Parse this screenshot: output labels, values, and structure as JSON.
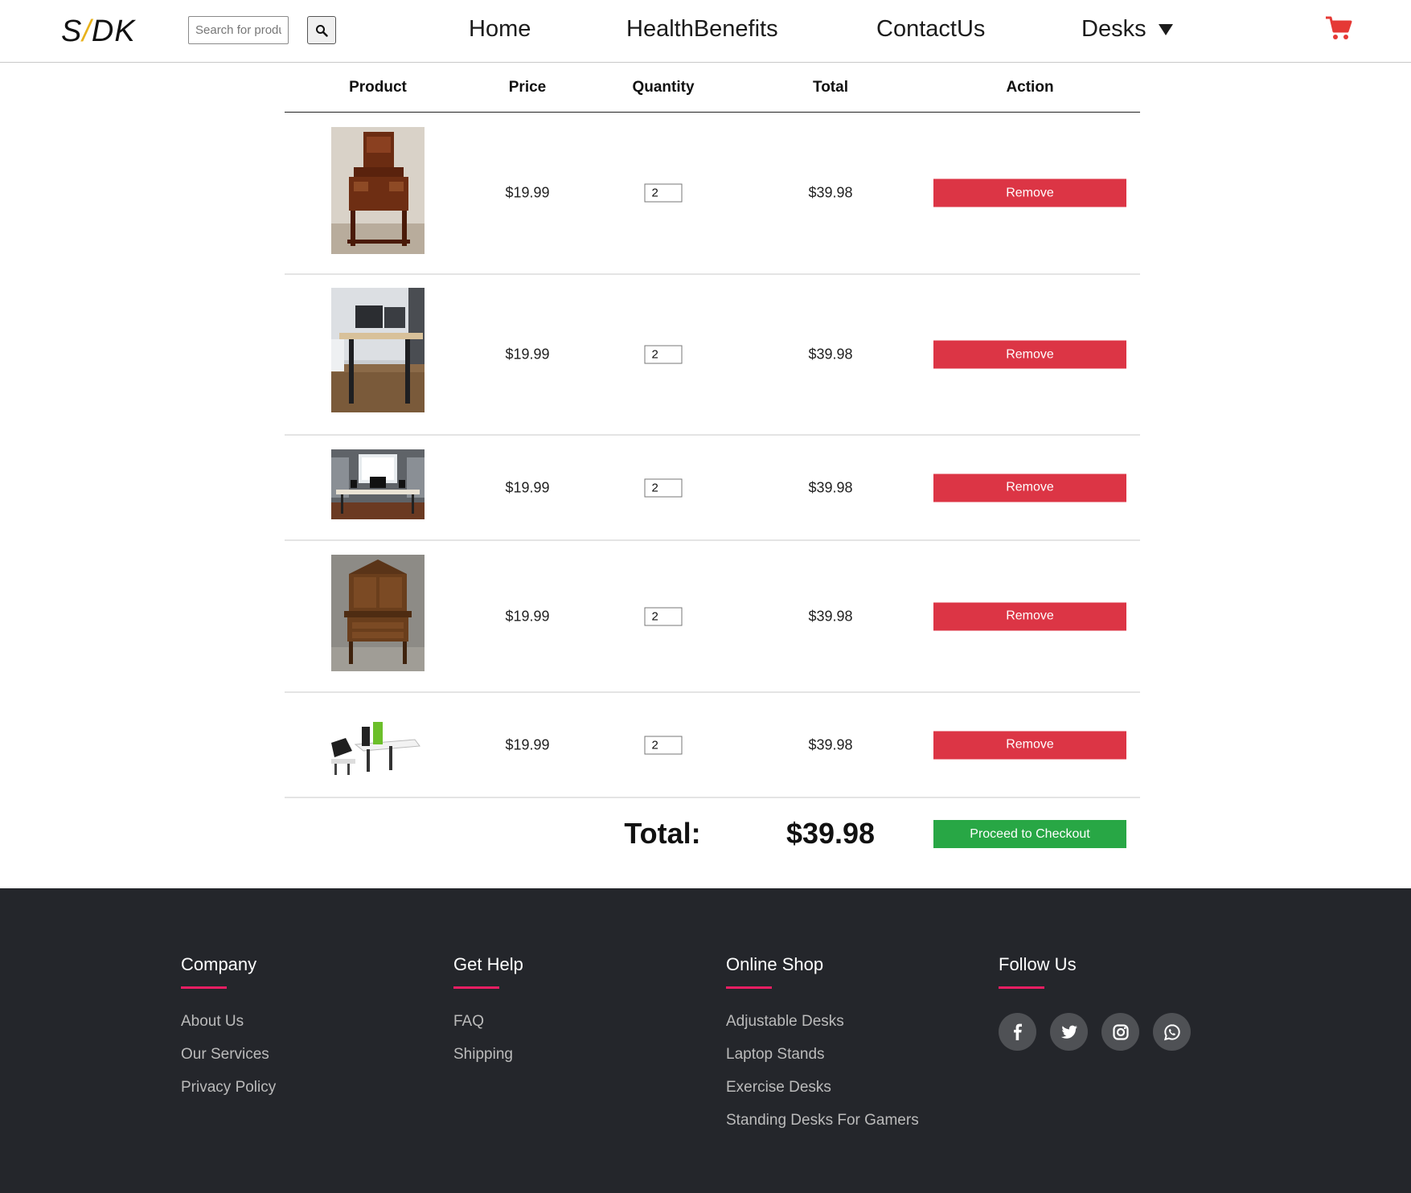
{
  "header": {
    "logo_left": "S",
    "logo_slash": "/",
    "logo_right": "DK",
    "search_placeholder": "Search for products",
    "search_icon": "search-icon",
    "nav": [
      "Home",
      "HealthBenefits",
      "ContactUs",
      "Desks"
    ],
    "dropdown_icon": "caret-down-icon",
    "cart_icon": "shopping-cart-icon",
    "cart_color": "#e53935"
  },
  "table": {
    "headers": [
      "Product",
      "Price",
      "Quantity",
      "Total",
      "Action"
    ],
    "rows": [
      {
        "image": "antique-secretary-desk",
        "price": "$19.99",
        "quantity": "2",
        "total": "$39.98",
        "action": "Remove"
      },
      {
        "image": "standing-desk-office",
        "price": "$19.99",
        "quantity": "2",
        "total": "$39.98",
        "action": "Remove"
      },
      {
        "image": "desk-with-monitors-window",
        "price": "$19.99",
        "quantity": "2",
        "total": "$39.98",
        "action": "Remove"
      },
      {
        "image": "antique-wooden-cabinet-desk",
        "price": "$19.99",
        "quantity": "2",
        "total": "$39.98",
        "action": "Remove"
      },
      {
        "image": "modern-white-workstation",
        "price": "$19.99",
        "quantity": "2",
        "total": "$39.98",
        "action": "Remove"
      }
    ],
    "total_label": "Total:",
    "total_value": "$39.98",
    "checkout_label": "Proceed to Checkout"
  },
  "footer": {
    "columns": [
      {
        "heading": "Company",
        "links": [
          "About Us",
          "Our Services",
          "Privacy Policy"
        ]
      },
      {
        "heading": "Get Help",
        "links": [
          "FAQ",
          "Shipping"
        ]
      },
      {
        "heading": "Online Shop",
        "links": [
          "Adjustable Desks",
          "Laptop Stands",
          "Exercise Desks",
          "Standing Desks For Gamers"
        ]
      },
      {
        "heading": "Follow Us",
        "social": [
          "facebook-icon",
          "twitter-icon",
          "instagram-icon",
          "whatsapp-icon"
        ]
      }
    ],
    "accent": "#e91e63",
    "background": "#24262b"
  },
  "colors": {
    "remove": "#dc3545",
    "checkout": "#28a745",
    "logo_slash": "#e8b21c"
  }
}
